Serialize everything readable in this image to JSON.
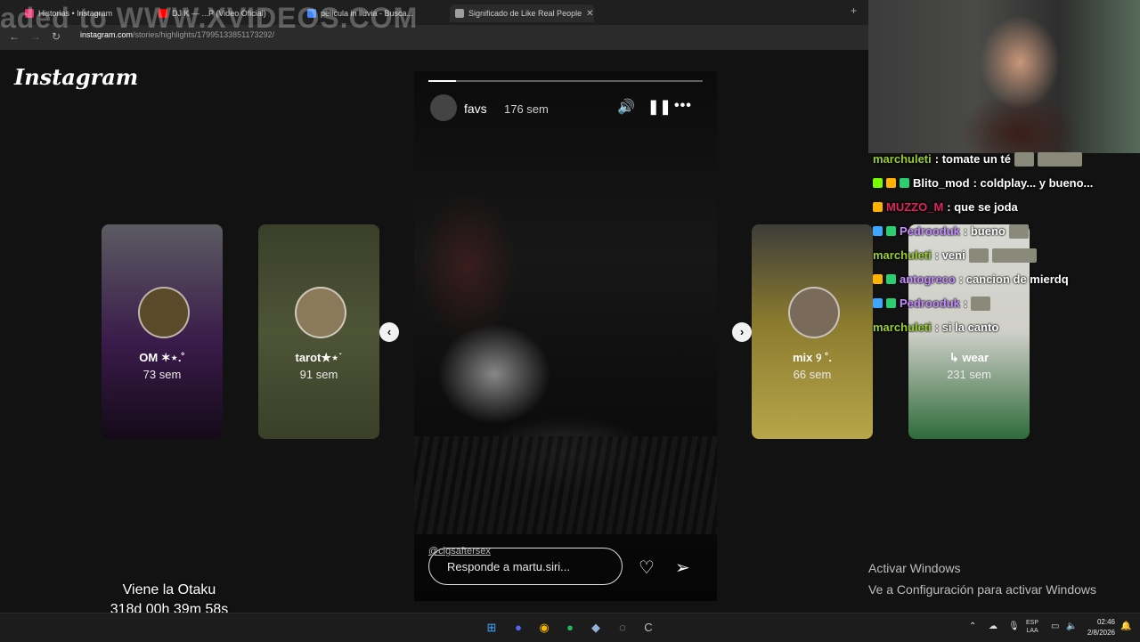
{
  "browser": {
    "tabs": [
      {
        "title": "Historias • Instagram",
        "active": false,
        "favicon_color": "#e1306c"
      },
      {
        "title": "DJ K — ...P (Video Oficial)",
        "active": false,
        "favicon_color": "#ff0000"
      },
      {
        "title": "película in lluvia - Busca...",
        "active": false,
        "favicon_color": "#4285f4"
      },
      {
        "title": "Significado de Like Real People",
        "active": true,
        "favicon_color": "#9e9e9e"
      }
    ],
    "new_tab_icon": "plus-icon",
    "url_host": "instagram.com",
    "url_path": "/stories/highlights/17995133851173292/",
    "watermark": "aded to WWW.XVIDEOS.COM"
  },
  "instagram": {
    "logo": "Instagram",
    "left_cards": [
      {
        "title": "OM ✶⋆.˚",
        "time": "73 sem",
        "bg": "#3a1b4a"
      },
      {
        "title": "tarot★⋆˙",
        "time": "91 sem",
        "bg": "#4e5436"
      }
    ],
    "right_cards": [
      {
        "title": "mix ୨ ˚.",
        "time": "66 sem",
        "bg": "#8a7a2e"
      },
      {
        "title": "↳ wear",
        "time": "231 sem",
        "bg": "#cfcfc8"
      }
    ],
    "story": {
      "user": "favs",
      "age": "176 sem",
      "progress": 0.1,
      "mention": "@cigsaftersex",
      "reply_placeholder": "Responde a martu.siri...",
      "prev_arrow": "chevron-left-icon",
      "next_arrow": "chevron-right-icon"
    }
  },
  "chat": [
    {
      "user": "marchuleti",
      "color": "#9acd32",
      "message": ": tomate un té",
      "badges": [],
      "emotes": 2
    },
    {
      "user": "Blito_mod",
      "color": "#ffffff",
      "message": ": coldplay... y bueno...",
      "badges": [
        "#7cfc00",
        "#ffb300",
        "#2ecc71"
      ],
      "emotes": 0
    },
    {
      "user": "MUZZO_M",
      "color": "#e0245e",
      "message": ": que se joda",
      "badges": [
        "#ffb300"
      ],
      "emotes": 0
    },
    {
      "user": "Pedrooduk",
      "color": "#c48cff",
      "message": ": bueno",
      "badges": [
        "#3ea6ff",
        "#2ecc71"
      ],
      "emotes": 1
    },
    {
      "user": "marchuleti",
      "color": "#9acd32",
      "message": ": veni",
      "badges": [],
      "emotes": 2
    },
    {
      "user": "antogreco",
      "color": "#c48cff",
      "message": ": cancion de mierdq",
      "badges": [
        "#ffb300",
        "#2ecc71"
      ],
      "emotes": 0
    },
    {
      "user": "Pedrooduk",
      "color": "#c48cff",
      "message": ":",
      "badges": [
        "#3ea6ff",
        "#2ecc71"
      ],
      "emotes": 1
    },
    {
      "user": "marchuleti",
      "color": "#9acd32",
      "message": ": si la canto",
      "badges": [],
      "emotes": 0
    }
  ],
  "activation": {
    "line1": "Activar Windows",
    "line2": "Ve a Configuración para activar Windows"
  },
  "overlay": {
    "title": "Viene la Otaku",
    "countdown": "318d 00h 39m 58s"
  },
  "taskbar": {
    "lang": "ESP",
    "region": "LAA",
    "time": "02:46",
    "date": "2/8/2026"
  }
}
